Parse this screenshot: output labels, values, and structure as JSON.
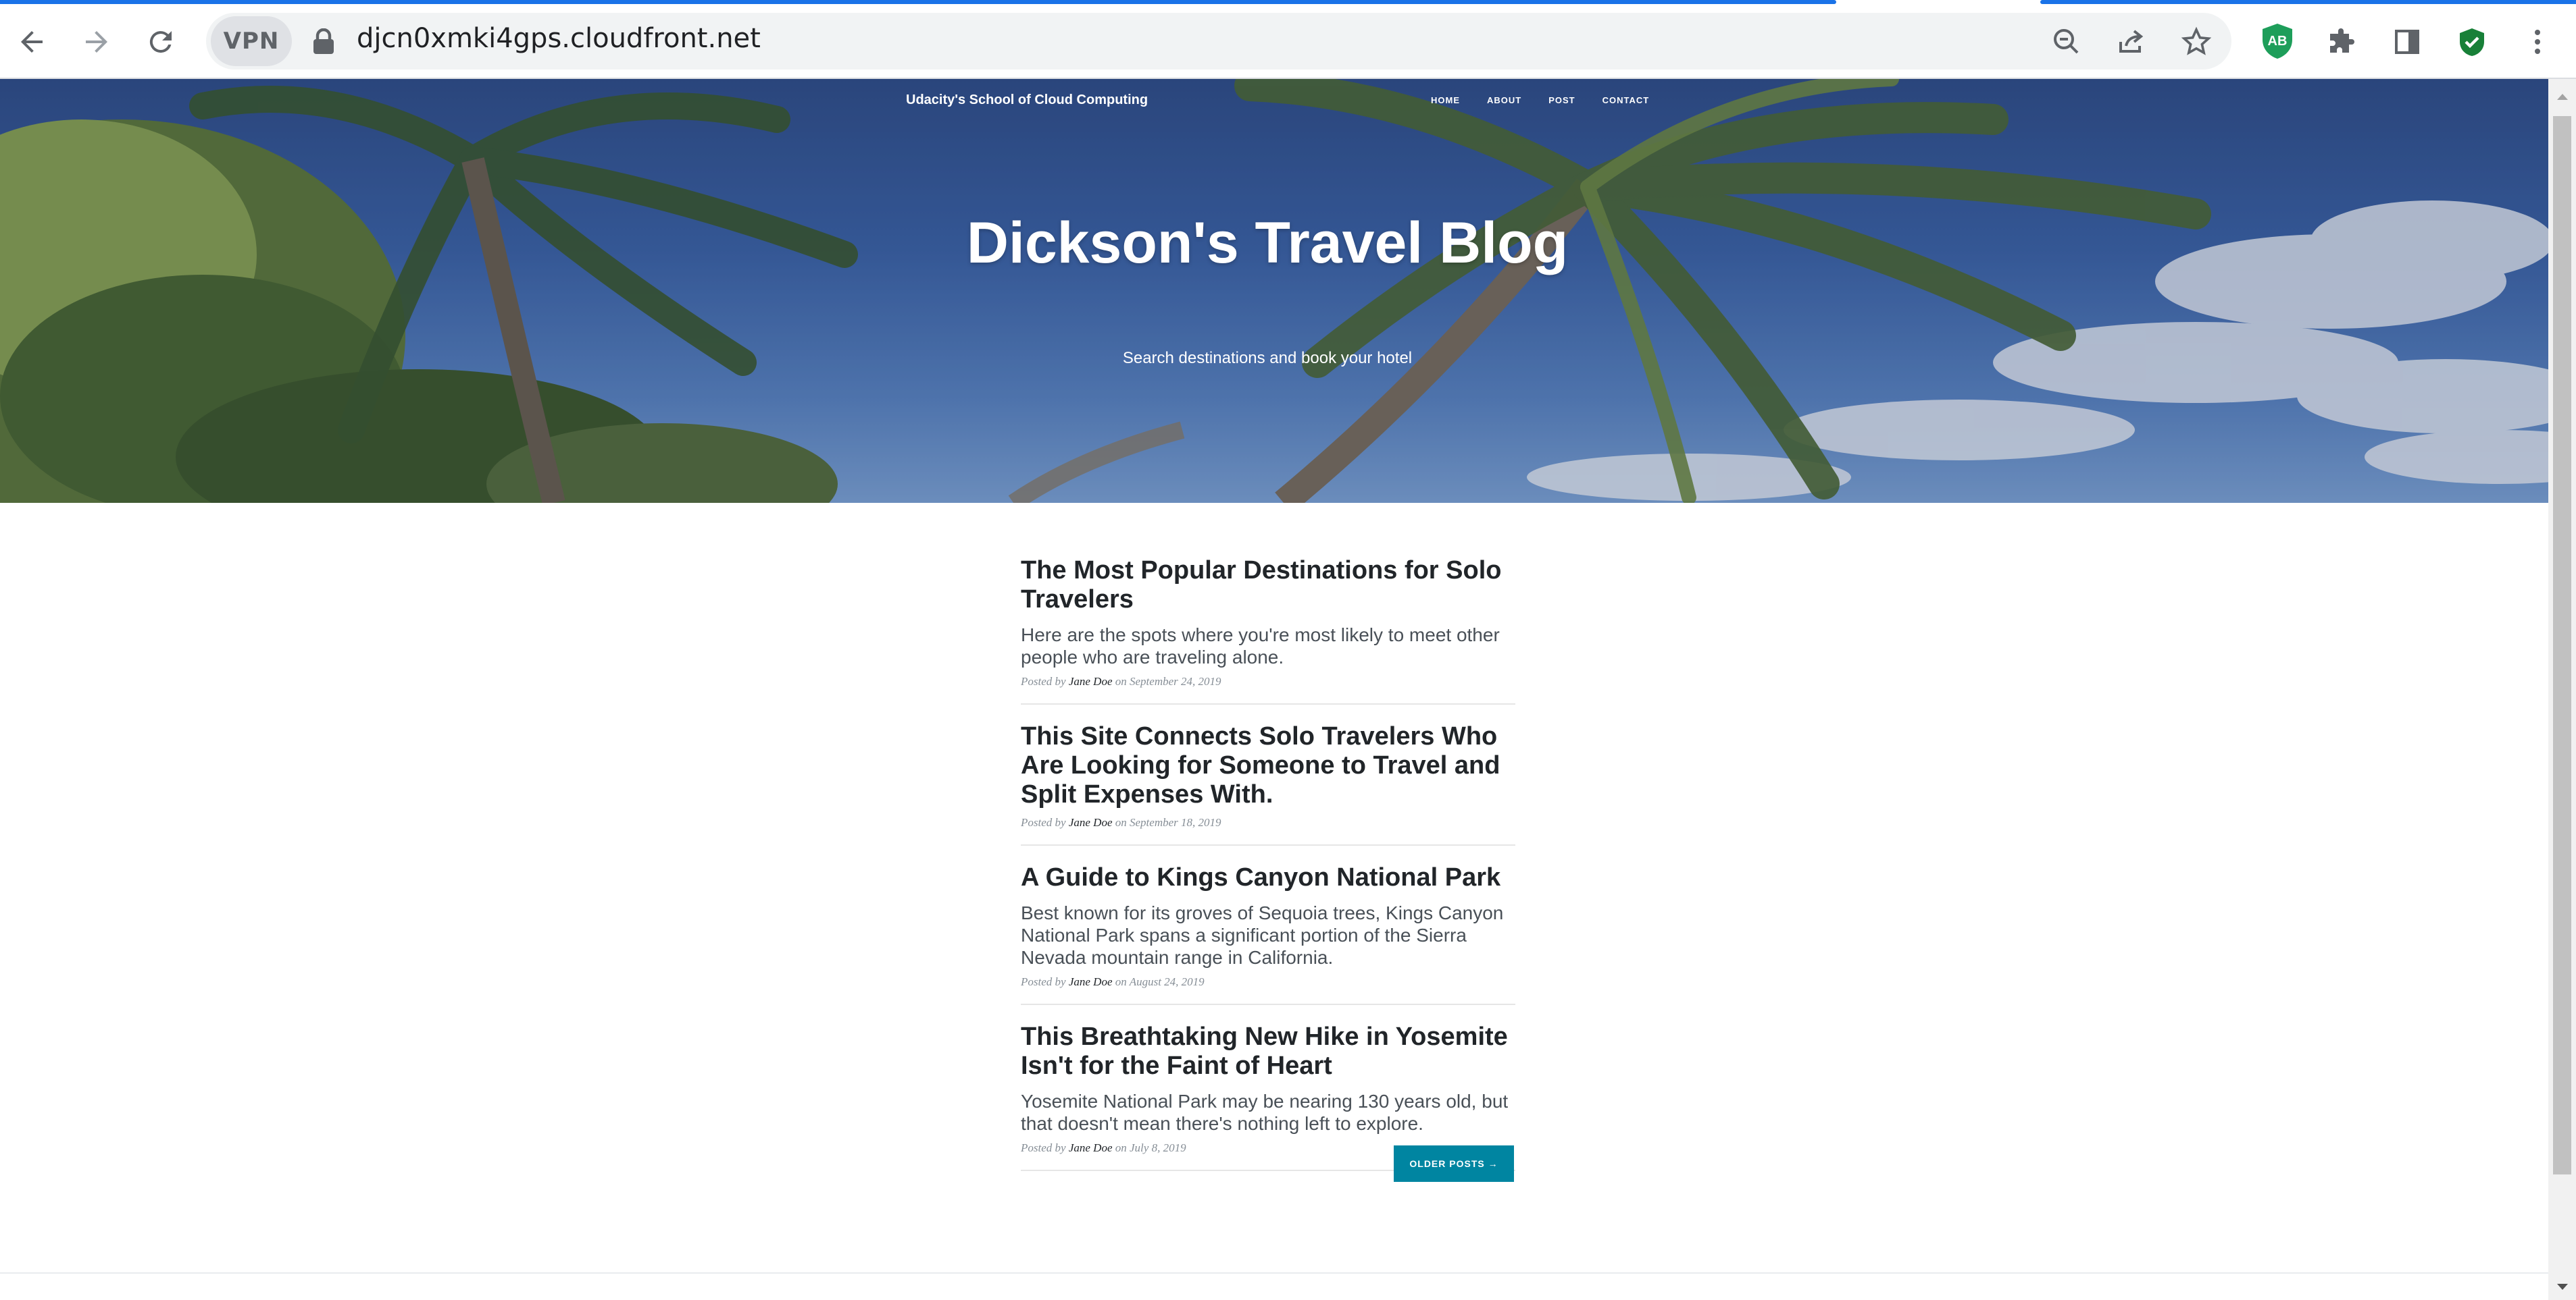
{
  "browser": {
    "vpn_label": "VPN",
    "url": "djcn0xmki4gps.cloudfront.net",
    "extension_badge": "AB",
    "accent_color": "#1a73e8"
  },
  "site": {
    "brand": "Udacity's School of Cloud Computing",
    "nav": [
      "Home",
      "About",
      "Post",
      "Contact"
    ],
    "hero_title": "Dickson's Travel Blog",
    "hero_subtitle": "Search destinations and book your hotel"
  },
  "posts": [
    {
      "title": "The Most Popular Destinations for Solo Travelers",
      "subtitle": "Here are the spots where you're most likely to meet other people who are traveling alone.",
      "posted_by": "Posted by",
      "author": "Jane Doe",
      "on": "on",
      "date": "September 24, 2019"
    },
    {
      "title": "This Site Connects Solo Travelers Who Are Looking for Someone to Travel and Split Expenses With.",
      "subtitle": "",
      "posted_by": "Posted by",
      "author": "Jane Doe",
      "on": "on",
      "date": "September 18, 2019"
    },
    {
      "title": "A Guide to Kings Canyon National Park",
      "subtitle": "Best known for its groves of Sequoia trees, Kings Canyon National Park spans a significant portion of the Sierra Nevada mountain range in California.",
      "posted_by": "Posted by",
      "author": "Jane Doe",
      "on": "on",
      "date": "August 24, 2019"
    },
    {
      "title": "This Breathtaking New Hike in Yosemite Isn't for the Faint of Heart",
      "subtitle": "Yosemite National Park may be nearing 130 years old, but that doesn't mean there's nothing left to explore.",
      "posted_by": "Posted by",
      "author": "Jane Doe",
      "on": "on",
      "date": "July 8, 2019"
    }
  ],
  "pager": {
    "older_label": "Older Posts →"
  },
  "colors": {
    "button": "#0085a1",
    "title": "#212529"
  }
}
